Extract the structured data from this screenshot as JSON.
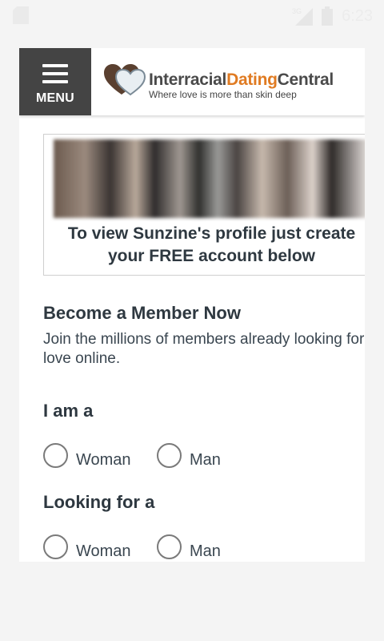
{
  "status_bar": {
    "time": "6:23",
    "network": "3G"
  },
  "header": {
    "menu_label": "MENU",
    "logo": {
      "word1": "Interracial",
      "word2": "Dating",
      "word3": "Central",
      "tagline": "Where love is more than skin deep"
    },
    "colors": {
      "menu_bg": "#444444",
      "accent": "#e07b22"
    }
  },
  "profile_promo": {
    "text": "To view Sunzine's profile just create your FREE account below"
  },
  "signup": {
    "title": "Become a Member Now",
    "description": "Join the millions of members already looking for love online."
  },
  "form": {
    "i_am": {
      "label": "I am a",
      "options": [
        "Woman",
        "Man"
      ]
    },
    "looking_for": {
      "label": "Looking for a",
      "options": [
        "Woman",
        "Man"
      ]
    }
  }
}
